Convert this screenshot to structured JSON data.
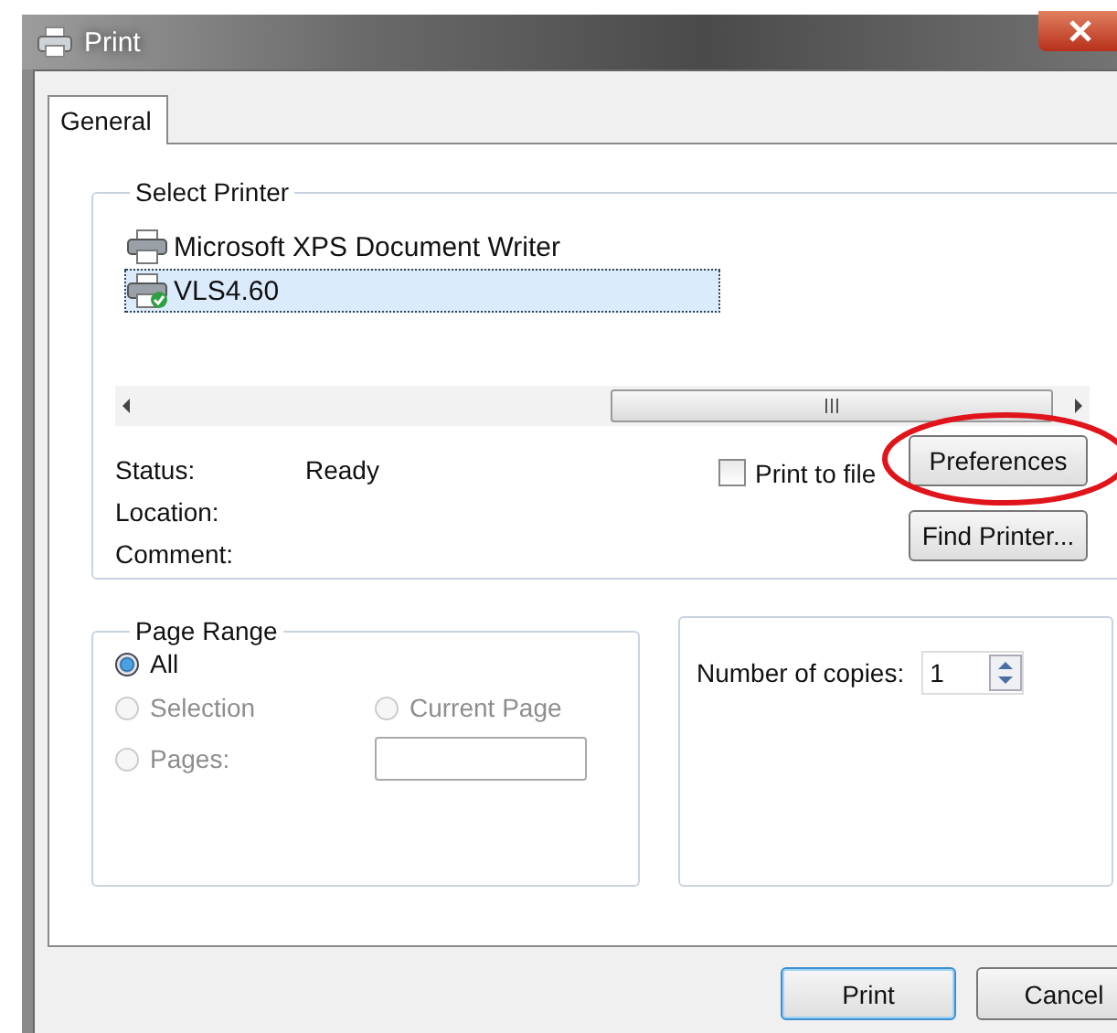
{
  "window": {
    "title": "Print"
  },
  "tabs": [
    {
      "label": "General",
      "selected": true
    }
  ],
  "select_printer": {
    "title": "Select Printer",
    "printers": [
      {
        "name": "Microsoft XPS Document Writer",
        "selected": false,
        "default": false
      },
      {
        "name": "VLS4.60",
        "selected": true,
        "default": true
      }
    ],
    "status_label": "Status:",
    "status": "Ready",
    "location_label": "Location:",
    "comment_label": "Comment:",
    "print_to_file": {
      "label": "Print to file",
      "checked": false
    },
    "buttons": [
      "Preferences",
      "Find Printer..."
    ]
  },
  "page_range": {
    "title": "Page Range",
    "options": [
      {
        "label": "All",
        "selected": true,
        "disabled": false
      },
      {
        "label": "Selection",
        "selected": false,
        "disabled": true
      },
      {
        "label": "Current Page",
        "selected": false,
        "disabled": true
      },
      {
        "label": "Pages:",
        "selected": false,
        "disabled": true
      }
    ]
  },
  "copies": {
    "label": "Number of copies:",
    "value": "1"
  },
  "buttons": [
    {
      "label": "Print",
      "default": true
    },
    {
      "label": "Cancel",
      "default": false
    }
  ],
  "annotation": {
    "kind": "ellipse"
  }
}
